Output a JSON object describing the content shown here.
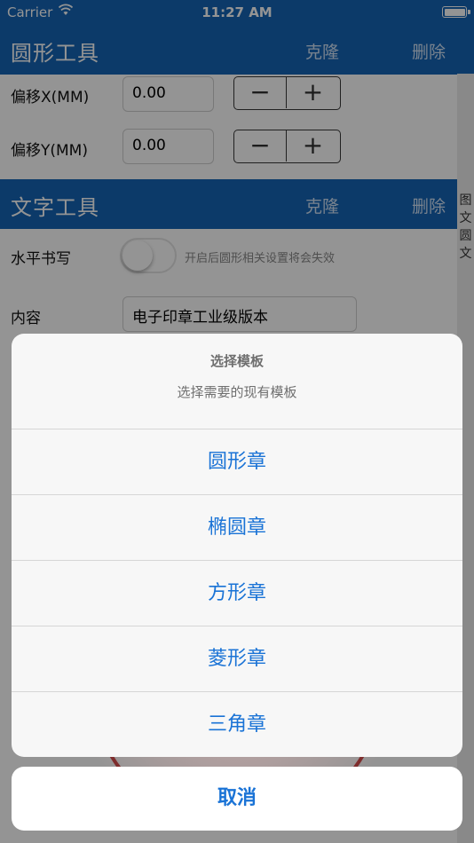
{
  "status_bar": {
    "carrier": "Carrier",
    "time": "11:27 AM"
  },
  "circle_tool": {
    "title": "圆形工具",
    "clone_label": "克隆",
    "delete_label": "删除",
    "offset_x": {
      "label": "偏移X(MM)",
      "value": "0.00"
    },
    "offset_y": {
      "label": "偏移Y(MM)",
      "value": "0.00"
    },
    "minus_symbol": "−",
    "plus_symbol": "+"
  },
  "text_tool": {
    "title": "文字工具",
    "clone_label": "克隆",
    "delete_label": "删除",
    "horizontal_label": "水平书写",
    "toggle_on": false,
    "toggle_hint": "开启后圆形相关设置将会失效",
    "content_label": "内容",
    "content_value": "电子印章工业级版本"
  },
  "side_tabs": [
    "图",
    "文",
    "圆",
    "文"
  ],
  "action_sheet": {
    "title": "选择模板",
    "message": "选择需要的现有模板",
    "options": [
      "圆形章",
      "椭圆章",
      "方形章",
      "菱形章",
      "三角章"
    ],
    "cancel": "取消"
  },
  "colors": {
    "header_blue": "#1565b5",
    "action_blue": "#1a73d6",
    "stamp_red": "#c62020"
  }
}
